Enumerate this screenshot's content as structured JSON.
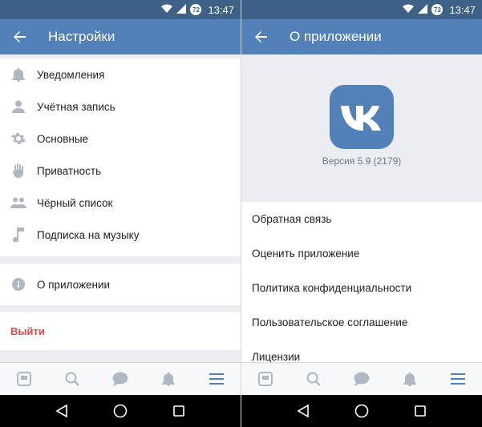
{
  "status": {
    "time": "13:47",
    "battery_badge": "72"
  },
  "settings": {
    "title": "Настройки",
    "items": [
      {
        "label": "Уведомления",
        "icon": "bell-icon"
      },
      {
        "label": "Учётная запись",
        "icon": "person-icon"
      },
      {
        "label": "Основные",
        "icon": "gear-icon"
      },
      {
        "label": "Приватность",
        "icon": "hand-icon"
      },
      {
        "label": "Чёрный список",
        "icon": "people-icon"
      },
      {
        "label": "Подписка на музыку",
        "icon": "music-note-icon"
      }
    ],
    "about_item": {
      "label": "О приложении",
      "icon": "info-icon"
    },
    "logout_label": "Выйти"
  },
  "about": {
    "title": "О приложении",
    "logo_text": "VK",
    "version": "Версия 5.9 (2179)",
    "items": [
      {
        "label": "Обратная связь"
      },
      {
        "label": "Оценить приложение"
      },
      {
        "label": "Политика конфиденциальности"
      },
      {
        "label": "Пользовательское соглашение"
      },
      {
        "label": "Лицензии"
      }
    ]
  },
  "colors": {
    "accent": "#5181b8",
    "statusbar": "#3e6287",
    "logout": "#e64646",
    "tab_active": "#5181b8",
    "tab_inactive": "#aeb7c2"
  },
  "tabs": [
    {
      "icon": "newsfeed-icon",
      "active": false
    },
    {
      "icon": "search-icon",
      "active": false
    },
    {
      "icon": "messages-icon",
      "active": false
    },
    {
      "icon": "notifications-icon",
      "active": false
    },
    {
      "icon": "menu-icon",
      "active": true
    }
  ]
}
